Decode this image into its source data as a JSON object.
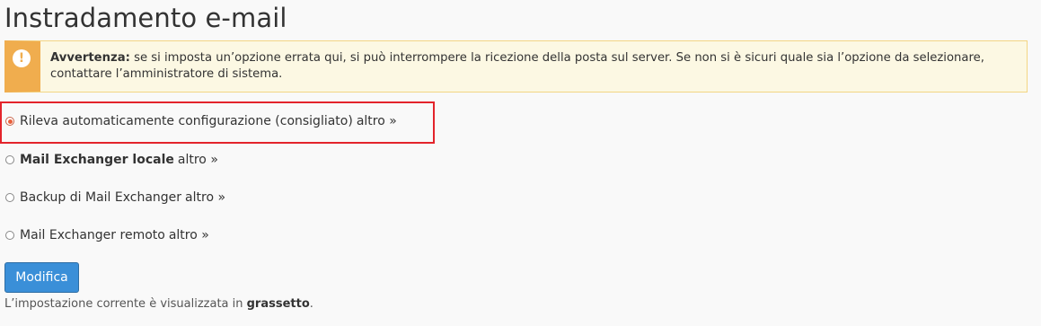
{
  "page_title": "Instradamento e-mail",
  "warning": {
    "icon": "exclamation-icon",
    "label": "Avvertenza:",
    "text": " se si imposta un’opzione errata qui, si può interrompere la ricezione della posta sul server. Se non si è sicuri quale sia l’opzione da selezionare, contattare l’amministratore di sistema."
  },
  "options": [
    {
      "label": "Rileva automaticamente configurazione (consigliato)",
      "more": "altro »",
      "checked": true,
      "bold": false
    },
    {
      "label": "Mail Exchanger locale",
      "more": "altro »",
      "checked": false,
      "bold": true
    },
    {
      "label": "Backup di Mail Exchanger",
      "more": "altro »",
      "checked": false,
      "bold": false
    },
    {
      "label": "Mail Exchanger remoto",
      "more": "altro »",
      "checked": false,
      "bold": false
    }
  ],
  "submit_label": "Modifica",
  "footnote": {
    "prefix": "L’impostazione corrente è visualizzata in ",
    "bold": "grassetto",
    "suffix": "."
  },
  "colors": {
    "warning_bg": "#fcf8e3",
    "warning_accent": "#f0ad4e",
    "button": "#3a8fd8",
    "highlight": "#e3242b"
  }
}
